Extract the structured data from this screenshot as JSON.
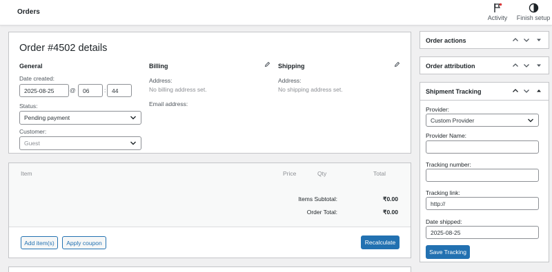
{
  "topbar": {
    "title": "Orders",
    "activity_label": "Activity",
    "finish_setup_label": "Finish setup"
  },
  "order": {
    "heading": "Order #4502 details",
    "general": {
      "title": "General",
      "date_label": "Date created:",
      "date_value": "2025-08-25",
      "at": "@",
      "hour": "06",
      "colon": ":",
      "minute": "44",
      "status_label": "Status:",
      "status_value": "Pending payment",
      "customer_label": "Customer:",
      "customer_placeholder": "Guest"
    },
    "billing": {
      "title": "Billing",
      "address_label": "Address:",
      "address_value": "No billing address set.",
      "email_label": "Email address:"
    },
    "shipping": {
      "title": "Shipping",
      "address_label": "Address:",
      "address_value": "No shipping address set."
    }
  },
  "items": {
    "columns": {
      "item": "Item",
      "price": "Price",
      "qty": "Qty",
      "total": "Total"
    },
    "subtotal_label": "Items Subtotal:",
    "subtotal_value": "₹0.00",
    "order_total_label": "Order Total:",
    "order_total_value": "₹0.00",
    "add_items_label": "Add item(s)",
    "apply_coupon_label": "Apply coupon",
    "recalculate_label": "Recalculate"
  },
  "sidebar": {
    "order_actions_title": "Order actions",
    "order_attribution_title": "Order attribution",
    "tracking": {
      "title": "Shipment Tracking",
      "provider_label": "Provider:",
      "provider_value": "Custom Provider",
      "provider_name_label": "Provider Name:",
      "tracking_number_label": "Tracking number:",
      "tracking_link_label": "Tracking link:",
      "tracking_link_value": "http://",
      "date_shipped_label": "Date shipped:",
      "date_shipped_value": "2025-08-25",
      "save_label": "Save Tracking"
    }
  },
  "colors": {
    "accent": "#2271b1",
    "background": "#f0f0f1",
    "border": "#c3c4c7"
  }
}
